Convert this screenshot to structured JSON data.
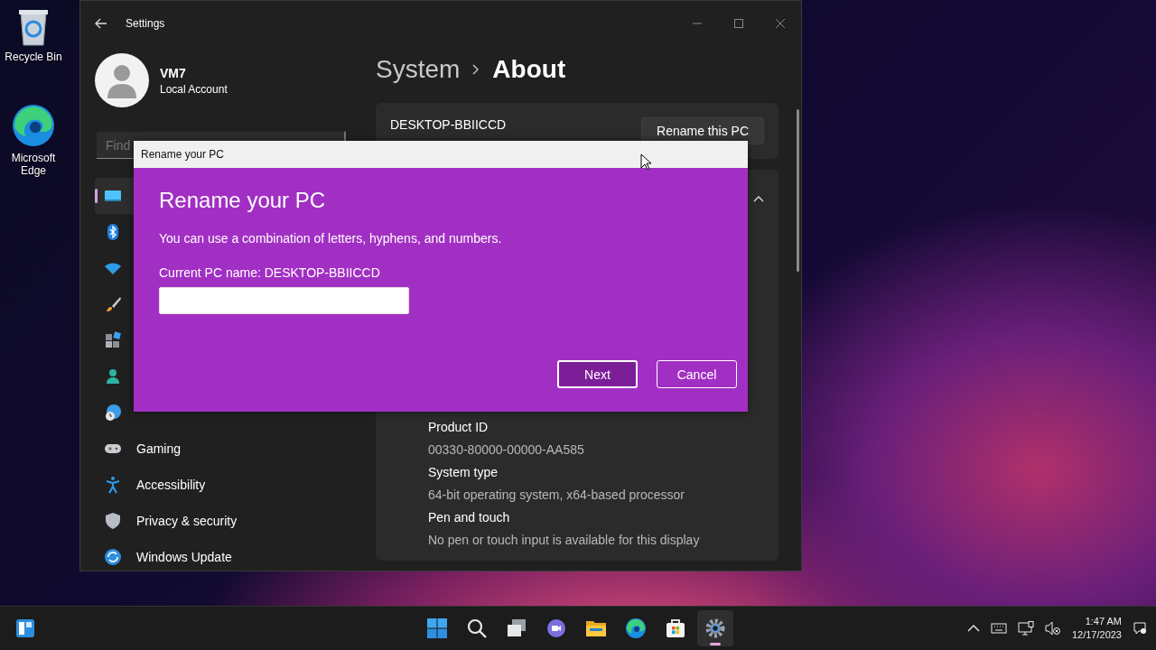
{
  "desktop_icons": [
    {
      "label": "Recycle Bin",
      "kind": "recycle"
    },
    {
      "label": "Microsoft Edge",
      "kind": "edge"
    }
  ],
  "settings": {
    "title": "Settings",
    "user": {
      "name": "VM7",
      "account": "Local Account"
    },
    "search": {
      "placeholder": "Find"
    },
    "nav": [
      {
        "kind": "system",
        "selected": true
      },
      {
        "kind": "bluetooth",
        "selected": false
      },
      {
        "kind": "network",
        "selected": false
      },
      {
        "kind": "brush",
        "selected": false
      },
      {
        "kind": "apps",
        "selected": false
      },
      {
        "kind": "accounts",
        "selected": false
      },
      {
        "kind": "time",
        "selected": false
      },
      {
        "label": "Gaming",
        "kind": "gaming",
        "selected": false
      },
      {
        "label": "Accessibility",
        "kind": "accessibility",
        "selected": false
      },
      {
        "label": "Privacy & security",
        "kind": "shield",
        "selected": false
      },
      {
        "label": "Windows Update",
        "kind": "update",
        "selected": false
      }
    ],
    "breadcrumb": {
      "parent": "System",
      "current": "About"
    },
    "device_card": {
      "name": "DESKTOP-BBIICCD",
      "button": "Rename this PC"
    },
    "specs_card": {
      "expanded": true,
      "rows": [
        {
          "label": "Product ID",
          "value": "00330-80000-00000-AA585"
        },
        {
          "label": "System type",
          "value": "64-bit operating system, x64-based processor"
        },
        {
          "label": "Pen and touch",
          "value": "No pen or touch input is available for this display"
        }
      ]
    }
  },
  "dialog": {
    "title": "Rename your PC",
    "heading": "Rename your PC",
    "description": "You can use a combination of letters, hyphens, and numbers.",
    "current_name": "Current PC name: DESKTOP-BBIICCD",
    "buttons": [
      {
        "label": "Next",
        "kind": "primary"
      },
      {
        "label": "Cancel",
        "kind": "secondary"
      }
    ]
  },
  "taskbar": {
    "apps": [
      {
        "kind": "start",
        "active": false
      },
      {
        "kind": "search",
        "active": false
      },
      {
        "kind": "taskview",
        "active": false
      },
      {
        "kind": "chat",
        "active": false
      },
      {
        "kind": "folder",
        "active": false
      },
      {
        "kind": "edge",
        "active": false
      },
      {
        "kind": "store",
        "active": false
      },
      {
        "kind": "settings",
        "active": true
      }
    ],
    "clock": {
      "time": "1:47 AM",
      "date": "12/17/2023"
    }
  }
}
